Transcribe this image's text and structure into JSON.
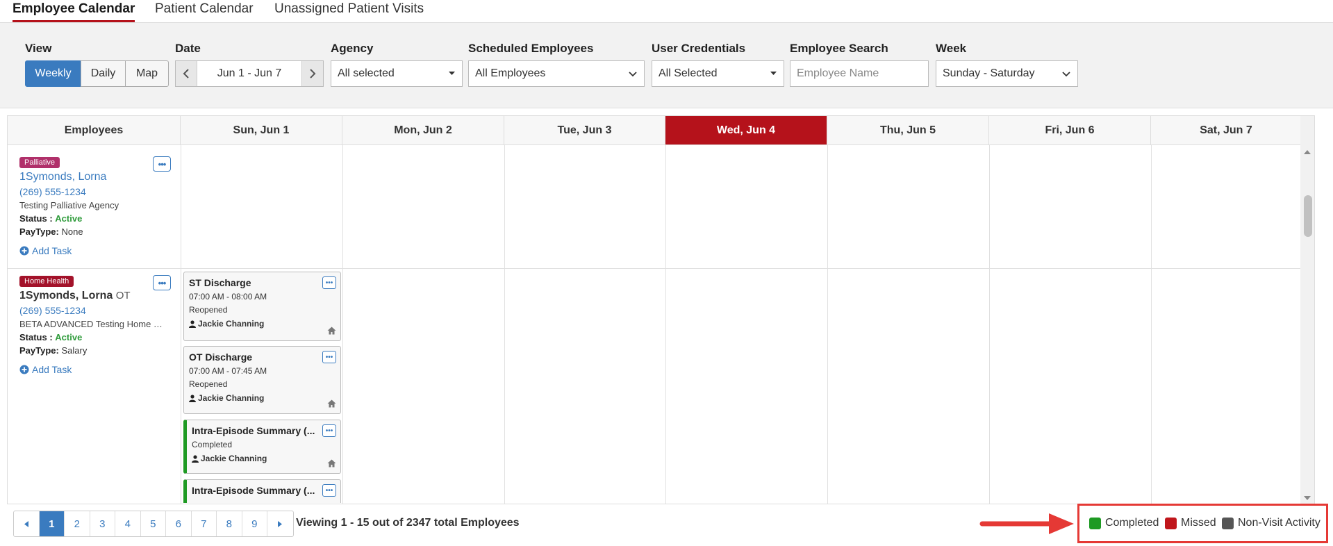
{
  "tabs": [
    "Employee Calendar",
    "Patient Calendar",
    "Unassigned Patient Visits"
  ],
  "filters": {
    "view_label": "View",
    "view_options": [
      "Weekly",
      "Daily",
      "Map"
    ],
    "date_label": "Date",
    "date_range": "Jun 1 - Jun 7",
    "agency_label": "Agency",
    "agency_value": "All selected",
    "scheduled_label": "Scheduled Employees",
    "scheduled_value": "All Employees",
    "credentials_label": "User Credentials",
    "credentials_value": "All Selected",
    "search_label": "Employee Search",
    "search_placeholder": "Employee Name",
    "week_label": "Week",
    "week_value": "Sunday - Saturday"
  },
  "calendar": {
    "employees_header": "Employees",
    "days": [
      "Sun, Jun 1",
      "Mon, Jun 2",
      "Tue, Jun 3",
      "Wed, Jun 4",
      "Thu, Jun 5",
      "Fri, Jun 6",
      "Sat, Jun 7"
    ],
    "today": "Wed, Jun 4"
  },
  "employees": [
    {
      "badge": "Palliative",
      "badge_color": "#b0306a",
      "name": "1Symonds, Lorna",
      "credential": "",
      "phone": "(269) 555-1234",
      "agency": "Testing Palliative Agency",
      "status_label": "Status :",
      "status": "Active",
      "paytype_label": "PayType:",
      "paytype": "None",
      "add_task": "Add Task"
    },
    {
      "badge": "Home Health",
      "badge_color": "#a3122a",
      "name": "1Symonds, Lorna",
      "credential": "OT",
      "phone": "(269) 555-1234",
      "agency": "BETA ADVANCED Testing Home H...",
      "status_label": "Status :",
      "status": "Active",
      "paytype_label": "PayType:",
      "paytype": "Salary",
      "add_task": "Add Task"
    }
  ],
  "cards": [
    {
      "title": "ST Discharge",
      "time": "07:00 AM - 08:00 AM",
      "status": "Reopened",
      "clinician": "Jackie Channing"
    },
    {
      "title": "OT Discharge",
      "time": "07:00 AM - 07:45 AM",
      "status": "Reopened",
      "clinician": "Jackie Channing"
    },
    {
      "title": "Intra-Episode Summary (...",
      "status": "Completed",
      "clinician": "Jackie Channing"
    },
    {
      "title": "Intra-Episode Summary (..."
    }
  ],
  "pagination": {
    "pages": [
      "1",
      "2",
      "3",
      "4",
      "5",
      "6",
      "7",
      "8",
      "9"
    ],
    "current": "1",
    "summary": "Viewing 1 - 15 out of 2347 total Employees"
  },
  "legend": [
    {
      "label": "Completed",
      "color": "#1e9a23"
    },
    {
      "label": "Missed",
      "color": "#c0161b"
    },
    {
      "label": "Non-Visit Activity",
      "color": "#555555"
    }
  ],
  "colors": {
    "accent": "#3a7bbf",
    "today": "#b5121b",
    "annotation": "#e53935"
  }
}
